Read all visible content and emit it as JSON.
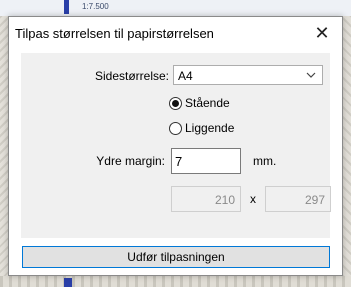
{
  "background": {
    "map_scale_label": "1:7.500"
  },
  "dialog": {
    "title": "Tilpas størrelsen til papirstørrelsen",
    "close_glyph": "✕",
    "page_size": {
      "label": "Sidestørrelse:",
      "value": "A4"
    },
    "orientation": {
      "portrait_label": "Stående",
      "landscape_label": "Liggende",
      "selected": "Stående"
    },
    "margin": {
      "label": "Ydre margin:",
      "value": "7",
      "unit": "mm."
    },
    "dimensions": {
      "width": "210",
      "separator": "x",
      "height": "297"
    },
    "apply_button": "Udfør tilpasningen"
  },
  "colors": {
    "accent_border": "#0078d7",
    "map_blue": "#2a3fa8"
  }
}
